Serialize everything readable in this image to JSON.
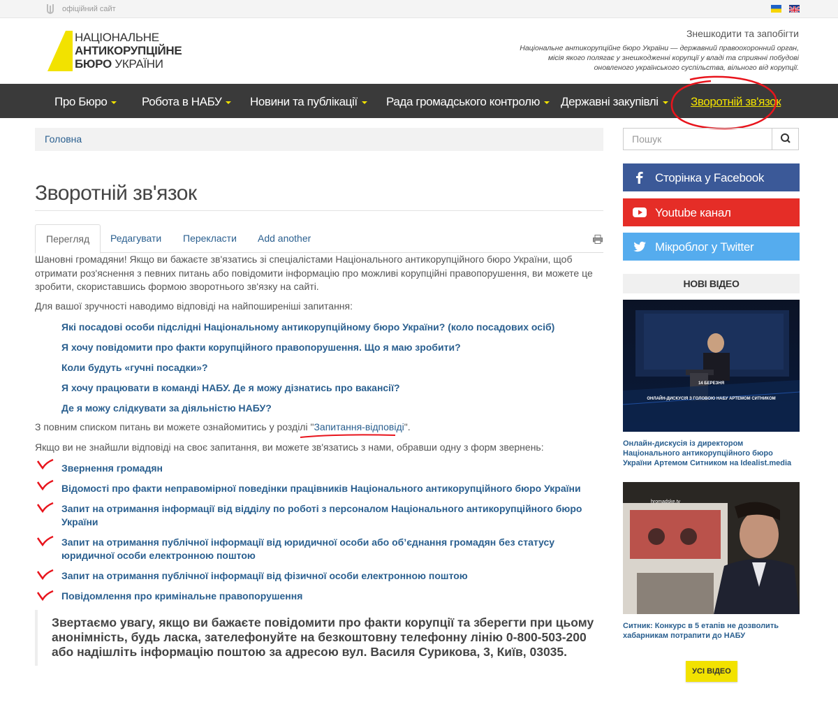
{
  "topbar": {
    "official": "офіційний сайт"
  },
  "logo": {
    "line1": "НАЦІОНАЛЬНЕ",
    "line2": "АНТИКОРУПЦІЙНЕ",
    "line3a": "БЮРО",
    "line3b": " УКРАЇНИ"
  },
  "header": {
    "tagline": "Знешкодити та запобігти",
    "mission": "Національне антикорупційне бюро України — державний правоохоронний орган, місія якого полягає у знешкодженні корупції у владі та сприянні побудові оновленого українського суспільства, вільного від корупції."
  },
  "nav": [
    {
      "label": "Про Бюро"
    },
    {
      "label": "Робота в НАБУ"
    },
    {
      "label": "Новини та публікації"
    },
    {
      "label": "Рада громадського контролю"
    },
    {
      "label": "Державні закупівлі"
    },
    {
      "label": "Зворотній зв'язок"
    }
  ],
  "breadcrumb": {
    "home": "Головна"
  },
  "page": {
    "title": "Зворотній зв'язок"
  },
  "tabs": [
    {
      "label": "Перегляд"
    },
    {
      "label": "Редагувати"
    },
    {
      "label": "Перекласти"
    },
    {
      "label": "Add another"
    }
  ],
  "content": {
    "intro": "Шановні громадяни! Якщо ви бажаєте зв'язатись зі спеціалістами Національного антикорупційного бюро України, щоб отримати роз'яснення з певних питань або повідомити інформацію про можливі корупційні правопорушення, ви можете це зробити, скориставшись формою зворотнього зв'язку на сайті.",
    "convenience": "Для вашої зручності наводимо відповіді на найпоширеніші запитання:",
    "faq": [
      "Які посадові особи підслідні Національному антикорупційному бюро України? (коло посадових осіб)",
      "Я хочу повідомити про факти корупційного правопорушення. Що я маю зробити?",
      "Коли будуть «гучні посадки»?",
      "Я хочу працювати в команді НАБУ. Де я можу дізнатись про вакансії?",
      "Де я можу слідкувати за діяльністю НАБУ?"
    ],
    "full_list_prefix": "З повним списком питань ви можете ознайомитись у розділі \"",
    "full_list_link": "Запитання-відповіді",
    "full_list_suffix": "\".",
    "not_found": "Якщо ви не знайшли відповіді на своє запитання, ви можете зв'язатись з нами, обравши одну з форм звернень:",
    "forms": [
      "Звернення громадян",
      "Відомості про факти неправомірної поведінки працівників Національного антикорупційного бюро України",
      "Запит на отримання інформації від відділу по роботі з персоналом Національного антикорупційного бюро України",
      "Запит на отримання публічної інформації від юридичної особи або об’єднання громадян без статусу юридичної особи електронною поштою",
      "Запит на отримання публічної інформації від фізичної особи електронною поштою",
      "Повідомлення про кримінальне правопорушення"
    ],
    "notice": "Звертаємо увагу, якщо ви бажаєте повідомити про факти корупції та зберегти при цьому анонімність, будь ласка, зателефонуйте на безкоштовну телефонну лінію 0-800-503-200 або надішліть інформацію поштою за адресою вул. Василя Сурикова, 3, Київ, 03035."
  },
  "sidebar": {
    "search_placeholder": "Пошук",
    "facebook": "Сторінка у Facebook",
    "youtube": "Youtube канал",
    "twitter": "Мікроблог у Twitter",
    "new_video": "НОВІ ВІДЕО",
    "video1_date": "14 БЕРЕЗНЯ",
    "video1_title": "ОНЛАЙН-ДИСКУСІЯ З ГОЛОВОЮ НАБУ АРТЕМОМ СИТНИКОМ",
    "video1_caption": "Онлайн-дискусія із директором Національного антикорупційного бюро України Артемом Ситником на Idealist.media",
    "video2_logo": "hromadske.tv",
    "video2_caption": "Ситник: Конкурс в 5 етапів не дозволить хабарникам потрапити до НАБУ",
    "all_video": "УСІ ВІДЕО"
  },
  "colors": {
    "accent": "#f2e200",
    "nav_bg": "#3a3a3a",
    "link": "#2a5f8f",
    "facebook": "#3b5998",
    "youtube": "#e52d27",
    "twitter": "#55acee",
    "annotation": "#e8141c"
  }
}
